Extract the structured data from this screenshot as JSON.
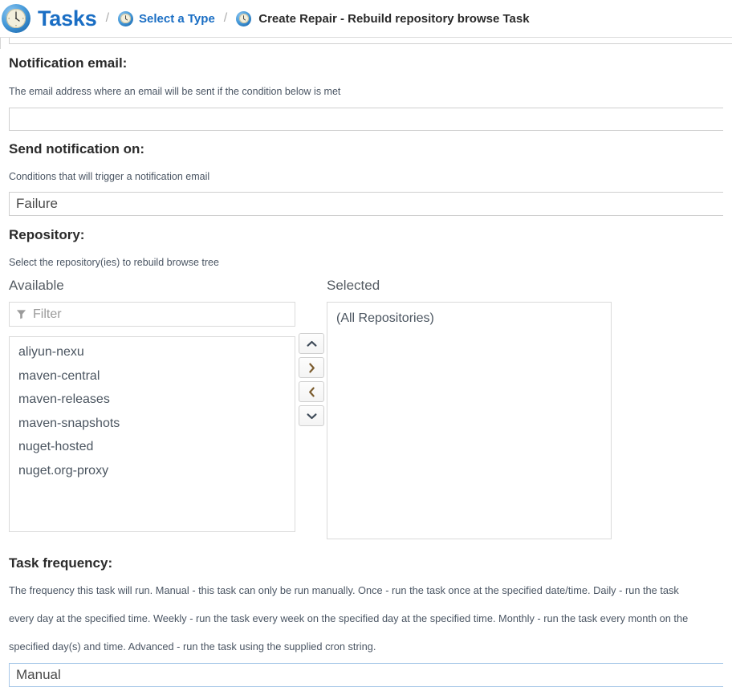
{
  "breadcrumb": {
    "root_label": "Tasks",
    "separator": "/",
    "type_label": "Select a Type",
    "current_label": "Create Repair - Rebuild repository browse Task",
    "root_icon": "clock-icon",
    "type_icon": "clock-icon",
    "current_icon": "clock-icon"
  },
  "notification_email": {
    "label": "Notification email:",
    "help": "The email address where an email will be sent if the condition below is met",
    "value": "",
    "placeholder": ""
  },
  "send_notification": {
    "label": "Send notification on:",
    "help": "Conditions that will trigger a notification email",
    "value": "Failure"
  },
  "repository": {
    "label": "Repository:",
    "help": "Select the repository(ies) to rebuild browse tree",
    "available_header": "Available",
    "selected_header": "Selected",
    "filter_placeholder": "Filter",
    "filter_value": "",
    "filter_icon": "funnel-icon",
    "available_items": [
      "aliyun-nexu",
      "maven-central",
      "maven-releases",
      "maven-snapshots",
      "nuget-hosted",
      "nuget.org-proxy"
    ],
    "selected_items": [
      "(All Repositories)"
    ],
    "transfer_buttons": [
      {
        "name": "move-up-button",
        "icon": "chevron-up-icon"
      },
      {
        "name": "move-right-button",
        "icon": "chevron-right-icon"
      },
      {
        "name": "move-left-button",
        "icon": "chevron-left-icon"
      },
      {
        "name": "move-down-button",
        "icon": "chevron-down-icon"
      }
    ]
  },
  "task_frequency": {
    "label": "Task frequency:",
    "help_line1": "The frequency this task will run. Manual - this task can only be run manually. Once - run the task once at the specified date/time. Daily - run the task",
    "help_line2": "every day at the specified time. Weekly - run the task every week on the specified day at the specified time. Monthly - run the task every month on the",
    "help_line3": "specified day(s) and time. Advanced - run the task using the supplied cron string.",
    "value": "Manual"
  },
  "colors": {
    "link": "#1a6ec4",
    "text": "#333333",
    "help_text": "#4a5563",
    "border": "#cfcfcf",
    "focus_border": "#a8c8e8"
  }
}
